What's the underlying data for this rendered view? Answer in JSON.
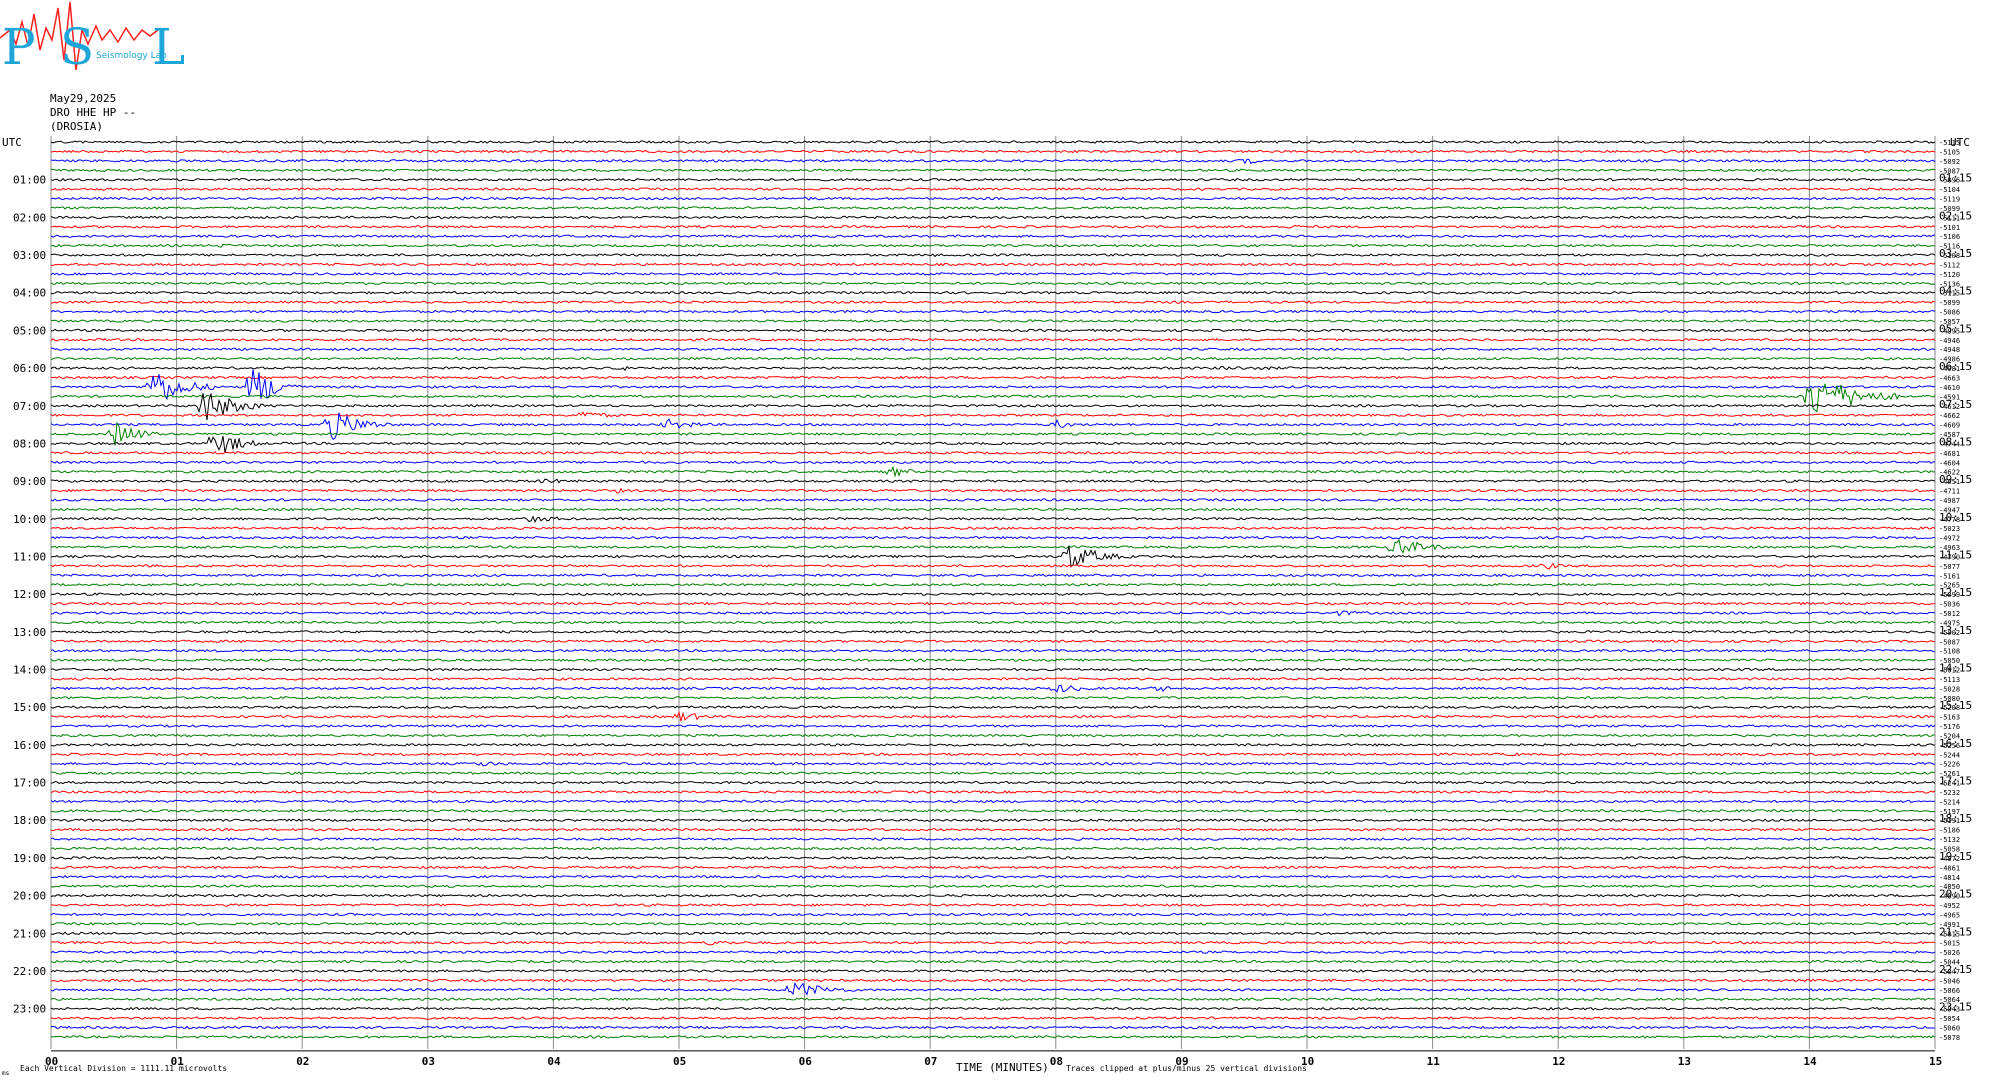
{
  "logo": {
    "big_letters": [
      "P",
      "S",
      "L"
    ],
    "small_text": "Seismology Lab"
  },
  "header": {
    "date": "May29,2025",
    "station": "DRO HHE HP --",
    "location": "(DROSIA)"
  },
  "chart_data": {
    "type": "line",
    "title": "",
    "xlabel": "TIME (MINUTES)",
    "ylabel": "UTC",
    "right_axis_label": "UTC",
    "xlim": [
      0,
      15
    ],
    "x_ticks": [
      "00",
      "01",
      "02",
      "03",
      "04",
      "05",
      "06",
      "07",
      "08",
      "09",
      "10",
      "11",
      "12",
      "13",
      "14",
      "15"
    ],
    "left_hour_labels": [
      "01:00",
      "02:00",
      "03:00",
      "04:00",
      "05:00",
      "06:00",
      "07:00",
      "08:00",
      "09:00",
      "10:00",
      "11:00",
      "12:00",
      "13:00",
      "14:00",
      "15:00",
      "16:00",
      "17:00",
      "18:00",
      "19:00",
      "20:00",
      "21:00",
      "22:00",
      "23:00"
    ],
    "right_hour_labels": [
      "01:15",
      "02:15",
      "03:15",
      "04:15",
      "05:15",
      "06:15",
      "07:15",
      "08:15",
      "09:15",
      "10:15",
      "11:15",
      "12:15",
      "13:15",
      "14:15",
      "15:15",
      "16:15",
      "17:15",
      "18:15",
      "19:15",
      "20:15",
      "21:15",
      "22:15",
      "23:15"
    ],
    "traces_per_hour": 4,
    "trace_colors": [
      "#000000",
      "#ff0000",
      "#0000ff",
      "#007f00"
    ],
    "trace_offsets": [
      "-5115",
      "-5105",
      "-5092",
      "-5087",
      "-5096",
      "-5104",
      "-5119",
      "-5099",
      "-5111",
      "-5101",
      "-5106",
      "-5116",
      "-5108",
      "-5112",
      "-5120",
      "-5136",
      "-5115",
      "-5099",
      "-5086",
      "-5057",
      "-4995",
      "-4946",
      "-4948",
      "-4986",
      "-4981",
      "-4663",
      "-4610",
      "-4591",
      "-4612",
      "-4662",
      "-4609",
      "-4587",
      "-4744",
      "-4681",
      "-4604",
      "-4622",
      "-4651",
      "-4711",
      "-4987",
      "-4947",
      "-4778",
      "-5023",
      "-4972",
      "-4963",
      "-4790",
      "-5077",
      "-5161",
      "-5265",
      "-5099",
      "-5036",
      "-5012",
      "-4975",
      "-5002",
      "-5087",
      "-5108",
      "-5050",
      "-5012",
      "-5113",
      "-5028",
      "-5080",
      "-5208",
      "-5163",
      "-5176",
      "-5204",
      "-5256",
      "-5244",
      "-5226",
      "-5261",
      "-5241",
      "-5232",
      "-5214",
      "-5197",
      "-5191",
      "-5186",
      "-5132",
      "-5058",
      "-4872",
      "-4861",
      "-4814",
      "-4850",
      "-4890",
      "-4952",
      "-4965",
      "-4991",
      "-5015",
      "-5015",
      "-5026",
      "-5044",
      "-5047",
      "-5046",
      "-5066",
      "-5064",
      "-5043",
      "-5054",
      "-5060",
      "-5078"
    ],
    "events": [
      {
        "trace": 2,
        "minute": 9.5,
        "amplitude": 4,
        "duration": 0.3
      },
      {
        "trace": 6,
        "minute": 3.2,
        "amplitude": 3,
        "duration": 0.4
      },
      {
        "trace": 6,
        "minute": 6.0,
        "amplitude": 2,
        "duration": 0.6
      },
      {
        "trace": 9,
        "minute": 9.8,
        "amplitude": 2,
        "duration": 1.3
      },
      {
        "trace": 11,
        "minute": 1.3,
        "amplitude": 3,
        "duration": 0.3
      },
      {
        "trace": 12,
        "minute": 7.0,
        "amplitude": 2,
        "duration": 0.3
      },
      {
        "trace": 12,
        "minute": 8.4,
        "amplitude": 2,
        "duration": 0.3
      },
      {
        "trace": 24,
        "minute": 4.5,
        "amplitude": 3,
        "duration": 0.5
      },
      {
        "trace": 24,
        "minute": 9.3,
        "amplitude": 2,
        "duration": 2.5
      },
      {
        "trace": 26,
        "minute": 0.8,
        "amplitude": 22,
        "duration": 0.5
      },
      {
        "trace": 26,
        "minute": 1.6,
        "amplitude": 24,
        "duration": 0.4
      },
      {
        "trace": 27,
        "minute": 14.0,
        "amplitude": 26,
        "duration": 0.7
      },
      {
        "trace": 28,
        "minute": 1.2,
        "amplitude": 20,
        "duration": 0.5
      },
      {
        "trace": 29,
        "minute": 4.2,
        "amplitude": 5,
        "duration": 0.5
      },
      {
        "trace": 30,
        "minute": 2.2,
        "amplitude": 18,
        "duration": 0.5
      },
      {
        "trace": 30,
        "minute": 4.9,
        "amplitude": 6,
        "duration": 0.5
      },
      {
        "trace": 30,
        "minute": 8.0,
        "amplitude": 5,
        "duration": 0.3
      },
      {
        "trace": 31,
        "minute": 0.5,
        "amplitude": 14,
        "duration": 0.4
      },
      {
        "trace": 32,
        "minute": 1.3,
        "amplitude": 16,
        "duration": 0.4
      },
      {
        "trace": 35,
        "minute": 6.7,
        "amplitude": 6,
        "duration": 0.3
      },
      {
        "trace": 36,
        "minute": 3.9,
        "amplitude": 3,
        "duration": 0.6
      },
      {
        "trace": 37,
        "minute": 4.5,
        "amplitude": 3,
        "duration": 0.2
      },
      {
        "trace": 40,
        "minute": 3.8,
        "amplitude": 4,
        "duration": 0.6
      },
      {
        "trace": 43,
        "minute": 10.7,
        "amplitude": 10,
        "duration": 0.5
      },
      {
        "trace": 44,
        "minute": 8.1,
        "amplitude": 14,
        "duration": 0.5
      },
      {
        "trace": 45,
        "minute": 11.9,
        "amplitude": 5,
        "duration": 0.2
      },
      {
        "trace": 50,
        "minute": 10.2,
        "amplitude": 3,
        "duration": 0.8
      },
      {
        "trace": 58,
        "minute": 8.0,
        "amplitude": 5,
        "duration": 0.5
      },
      {
        "trace": 58,
        "minute": 8.8,
        "amplitude": 4,
        "duration": 0.3
      },
      {
        "trace": 61,
        "minute": 5.0,
        "amplitude": 6,
        "duration": 0.4
      },
      {
        "trace": 65,
        "minute": 11.6,
        "amplitude": 2,
        "duration": 0.6
      },
      {
        "trace": 66,
        "minute": 3.4,
        "amplitude": 3,
        "duration": 0.6
      },
      {
        "trace": 68,
        "minute": 4.0,
        "amplitude": 3,
        "duration": 0.3
      },
      {
        "trace": 85,
        "minute": 5.2,
        "amplitude": 3,
        "duration": 0.8
      },
      {
        "trace": 90,
        "minute": 5.9,
        "amplitude": 9,
        "duration": 0.6
      }
    ],
    "grid": true,
    "legend": "none"
  },
  "footer": {
    "scale_note": "Each Vertical Division = 1111.11 microvolts",
    "clip_note": "Traces clipped at plus/minus 25 vertical divisions",
    "corner_mark": "ms"
  }
}
